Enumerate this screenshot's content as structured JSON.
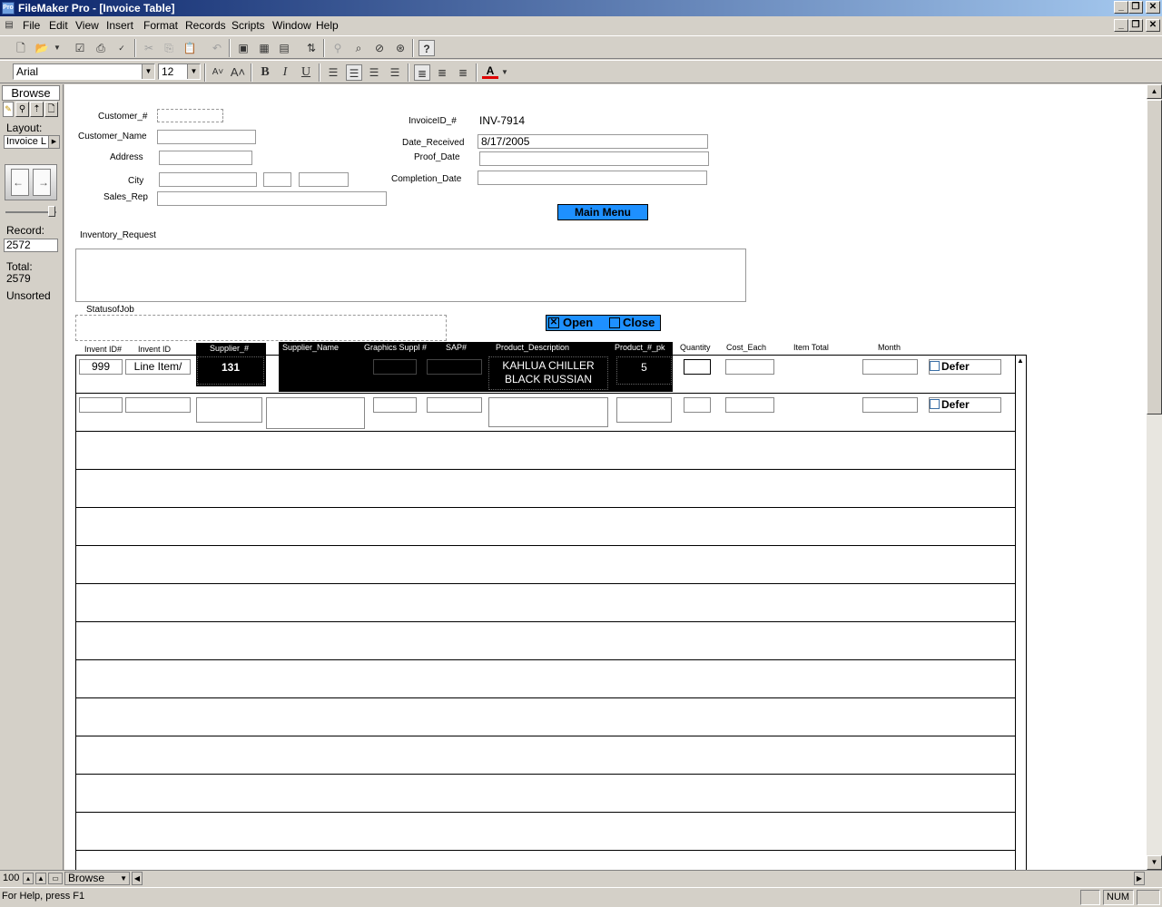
{
  "window": {
    "title": "FileMaker Pro - [Invoice Table]",
    "app_icon": "Pro"
  },
  "menu": [
    "File",
    "Edit",
    "View",
    "Insert",
    "Format",
    "Records",
    "Scripts",
    "Window",
    "Help"
  ],
  "formatbar": {
    "font": "Arial",
    "size": "12"
  },
  "sidebar": {
    "mode": "Browse",
    "layout_label": "Layout:",
    "layout_value": "Invoice L",
    "record_label": "Record:",
    "record_value": "2572",
    "total_label": "Total:",
    "total_value": "2579",
    "sort_status": "Unsorted"
  },
  "form": {
    "customer_num_label": "Customer_#",
    "customer_name_label": "Customer_Name",
    "address_label": "Address",
    "city_label": "City",
    "sales_rep_label": "Sales_Rep",
    "invoice_id_label": "InvoiceID_#",
    "invoice_id_value": "INV-7914",
    "date_received_label": "Date_Received",
    "date_received_value": "8/17/2005",
    "proof_date_label": "Proof_Date",
    "completion_date_label": "Completion_Date",
    "main_menu_button": "Main Menu",
    "inventory_request_label": "Inventory_Request",
    "status_of_job_label": "StatusofJob",
    "open_label": "Open",
    "close_label": "Close"
  },
  "portal": {
    "headers": {
      "invent_id_num": "Invent ID#",
      "invent_id": "Invent ID",
      "supplier_num": "Supplier_#",
      "supplier_name": "Supplier_Name",
      "graphics_suppl": "Graphics Suppl #",
      "sap": "SAP#",
      "product_description": "Product_Description",
      "product_pk": "Product_#_pk",
      "quantity": "Quantity",
      "cost_each": "Cost_Each",
      "item_total": "Item Total",
      "month": "Month"
    },
    "row1": {
      "invent_id_num": "999",
      "invent_id": "Line Item/",
      "supplier_num": "131",
      "product_description_1": "KAHLUA CHILLER",
      "product_description_2": "BLACK RUSSIAN",
      "product_pk": "5",
      "defer": "Defer"
    },
    "row2": {
      "defer": "Defer"
    }
  },
  "bottombar": {
    "zoom": "100",
    "mode": "Browse"
  },
  "status": {
    "help": "For Help, press F1",
    "num": "NUM"
  }
}
